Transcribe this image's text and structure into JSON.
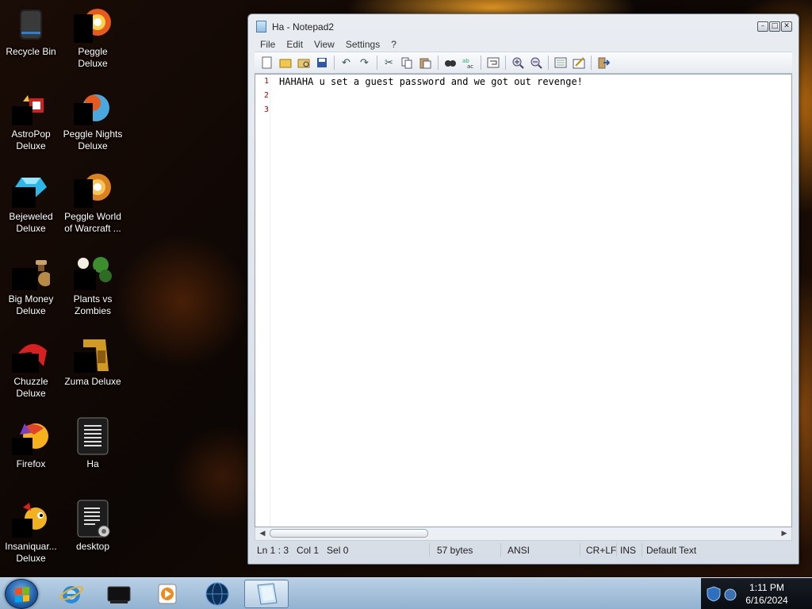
{
  "desktop": {
    "icons": [
      {
        "label": "Recycle Bin",
        "icon": "recycle-bin-icon"
      },
      {
        "label": "Peggle Deluxe",
        "icon": "peggle-icon"
      },
      {
        "label": "AstroPop Deluxe",
        "icon": "astropop-icon"
      },
      {
        "label": "Peggle Nights Deluxe",
        "icon": "peggle-nights-icon"
      },
      {
        "label": "Bejeweled Deluxe",
        "icon": "bejeweled-icon"
      },
      {
        "label": "Peggle World of Warcraft ...",
        "icon": "peggle-wow-icon"
      },
      {
        "label": "Big Money Deluxe",
        "icon": "big-money-icon"
      },
      {
        "label": "Plants vs Zombies",
        "icon": "plants-vs-zombies-icon"
      },
      {
        "label": "Chuzzle Deluxe",
        "icon": "chuzzle-icon"
      },
      {
        "label": "Zuma Deluxe",
        "icon": "zuma-icon"
      },
      {
        "label": "Firefox",
        "icon": "firefox-icon"
      },
      {
        "label": "Ha",
        "icon": "text-file-icon"
      },
      {
        "label": "Insaniquar... Deluxe",
        "icon": "insaniquarium-icon"
      },
      {
        "label": "desktop",
        "icon": "text-file-shortcut-icon"
      }
    ]
  },
  "window": {
    "title": "Ha - Notepad2",
    "menu": [
      "File",
      "Edit",
      "View",
      "Settings",
      "?"
    ],
    "toolbar_icons": [
      "new-file-icon",
      "open-file-icon",
      "browse-icon",
      "save-icon",
      "undo-icon",
      "redo-icon",
      "cut-icon",
      "copy-icon",
      "paste-icon",
      "find-icon",
      "replace-icon",
      "word-wrap-icon",
      "zoom-in-icon",
      "zoom-out-icon",
      "scheme-icon",
      "customize-scheme-icon",
      "exit-icon"
    ],
    "editor": {
      "line_numbers": [
        "1",
        "2",
        "3"
      ],
      "lines": [
        "HAHAHA u set a guest password and we got out revenge!",
        "",
        ""
      ]
    },
    "status": {
      "position": "Ln 1 : 3   Col 1   Sel 0",
      "size": "57 bytes",
      "encoding": "ANSI",
      "line_endings": "CR+LF",
      "mode": "INS",
      "scheme": "Default Text"
    }
  },
  "taskbar": {
    "apps": [
      "internet-explorer-icon",
      "media-center-icon",
      "windows-media-player-icon",
      "network-globe-icon",
      "notepad2-icon"
    ],
    "tray_icons": [
      "security-shield-icon",
      "network-icon"
    ],
    "time": "1:11 PM",
    "date": "6/16/2024"
  }
}
